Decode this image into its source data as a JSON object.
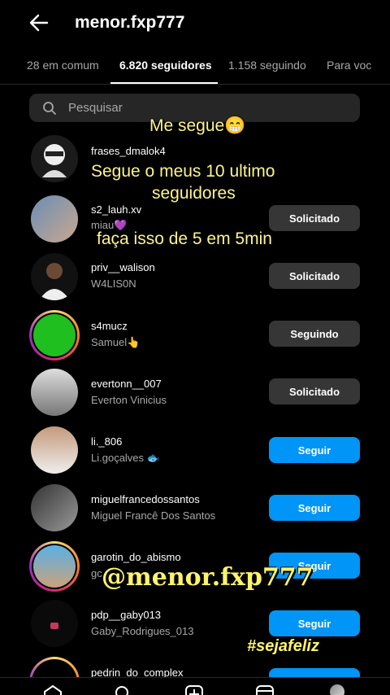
{
  "header": {
    "title": "menor.fxp777"
  },
  "tabs": [
    {
      "label": "28 em comum"
    },
    {
      "label": "6.820 seguidores"
    },
    {
      "label": "1.158 seguindo"
    },
    {
      "label": "Para voc"
    }
  ],
  "search": {
    "placeholder": "Pesquisar"
  },
  "rows": [
    {
      "username": "frases_dmalok4",
      "fullname": "",
      "button": ""
    },
    {
      "username": "s2_lauh.xv",
      "fullname": "miau💜",
      "button": "Solicitado"
    },
    {
      "username": "priv__walison",
      "fullname": "W4LIS0N",
      "button": "Solicitado"
    },
    {
      "username": "s4mucz",
      "fullname": "Samuel👆",
      "button": "Seguindo"
    },
    {
      "username": "evertonn__007",
      "fullname": "Everton Vinicius",
      "button": "Solicitado"
    },
    {
      "username": "li._806",
      "fullname": "Li.goçalves 🐟",
      "button": "Seguir"
    },
    {
      "username": "miguelfrancedossantos",
      "fullname": "Miguel Francê Dos Santos",
      "button": "Seguir"
    },
    {
      "username": "garotin_do_abismo",
      "fullname": "gc",
      "button": "Seguir"
    },
    {
      "username": "pdp__gaby013",
      "fullname": "Gaby_Rodrigues_013",
      "button": "Seguir"
    },
    {
      "username": "pedrin_do_complex",
      "fullname": "",
      "button": ""
    }
  ],
  "overlay": {
    "line1": "Me segue😁",
    "line2": "Segue o meus 10 ultimo",
    "line3": "seguidores",
    "line4": "faça isso de 5 em 5min",
    "handle": "@menor.fxp777",
    "hashtag": "#sejafeliz"
  },
  "colors": {
    "accent": "#0095f6",
    "overlay_text": "#fff58a"
  }
}
